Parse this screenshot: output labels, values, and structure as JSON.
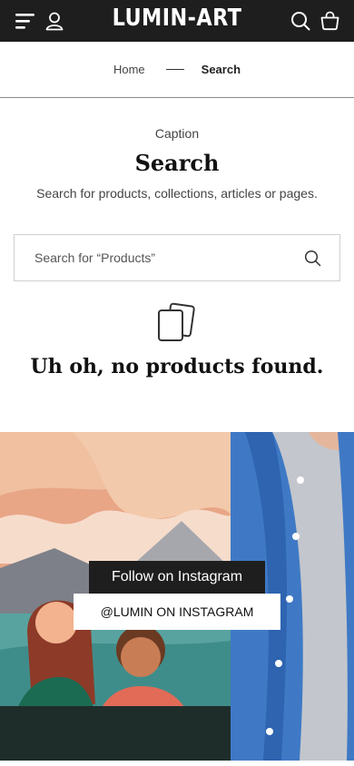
{
  "header": {
    "logo": "LUMIN-ART",
    "icons": [
      "menu-icon",
      "account-icon",
      "search-icon",
      "cart-icon"
    ]
  },
  "breadcrumb": {
    "home": "Home",
    "current": "Search"
  },
  "page": {
    "caption": "Caption",
    "title": "Search",
    "subtitle": "Search for products, collections, articles or pages."
  },
  "search": {
    "placeholder": "Search for “Products”",
    "value": ""
  },
  "empty_state": {
    "icon": "empty-box-icon",
    "message": "Uh oh, no products found."
  },
  "instagram": {
    "follow_label": "Follow on Instagram",
    "button_label": "@LUMIN ON INSTAGRAM"
  },
  "colors": {
    "header_bg": "#1e1e1e",
    "text": "#222222",
    "border": "#cfcfcf"
  }
}
